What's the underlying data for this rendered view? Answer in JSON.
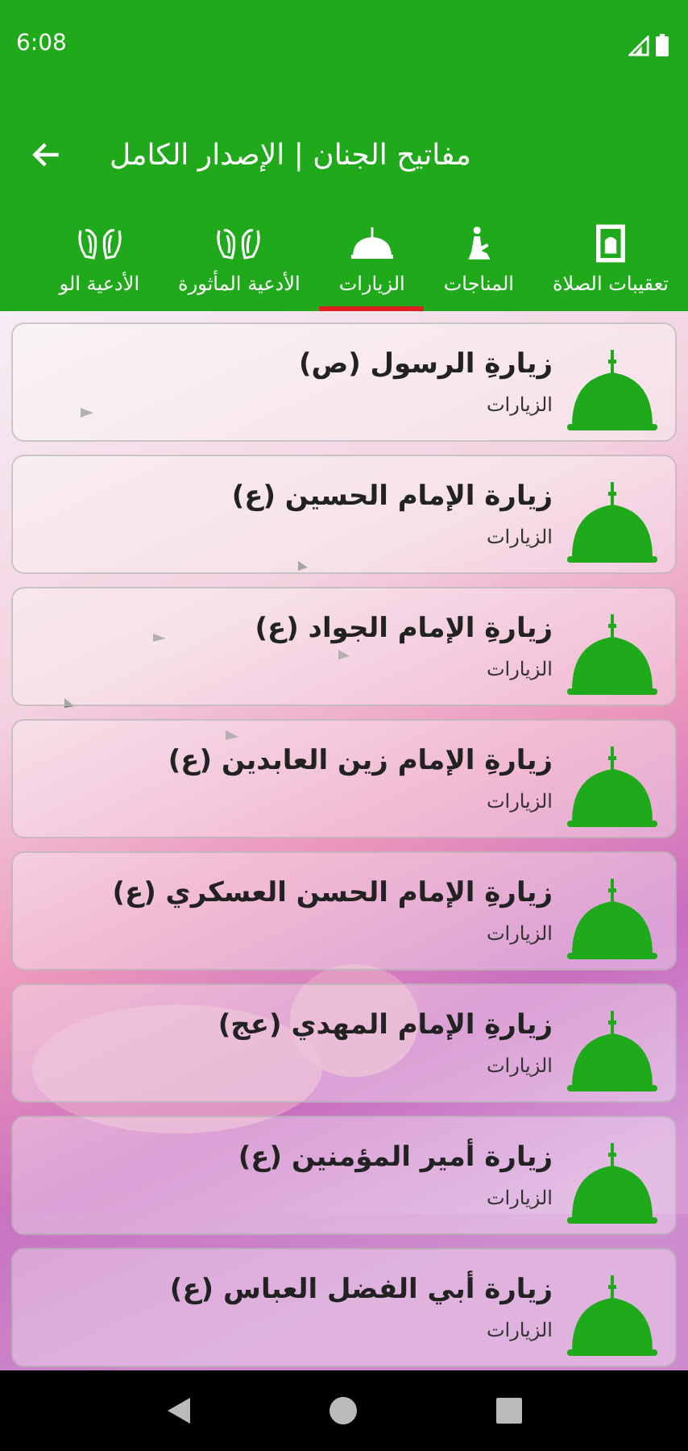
{
  "status_bar": {
    "time": "6:08"
  },
  "toolbar": {
    "title": "مفاتيح الجنان | الإصدار الكامل"
  },
  "tabs": [
    {
      "label": "تعقيبات الصلاة",
      "kind": "frame",
      "selected": false
    },
    {
      "label": "المناجات",
      "kind": "prayer",
      "selected": false
    },
    {
      "label": "الزيارات",
      "kind": "dome",
      "selected": true
    },
    {
      "label": "الأدعية المأثورة",
      "kind": "hands",
      "selected": false
    },
    {
      "label": "الأدعية الو",
      "kind": "hands",
      "selected": false
    }
  ],
  "list": [
    {
      "title": "زيارةِ الرسول (ص)",
      "subtitle": "الزيارات"
    },
    {
      "title": "زيارة الإمام الحسين (ع)",
      "subtitle": "الزيارات"
    },
    {
      "title": "زيارةِ الإمام الجواد (ع)",
      "subtitle": "الزيارات"
    },
    {
      "title": "زيارةِ الإمام زين العابدين (ع)",
      "subtitle": "الزيارات"
    },
    {
      "title": "زيارةِ الإمام الحسن العسكري (ع)",
      "subtitle": "الزيارات"
    },
    {
      "title": "زيارةِ الإمام المهدي (عج)",
      "subtitle": "الزيارات"
    },
    {
      "title": "زيارة أمير المؤمنين (ع)",
      "subtitle": "الزيارات"
    },
    {
      "title": "زيارة أبي الفضل العباس (ع)",
      "subtitle": "الزيارات"
    }
  ]
}
